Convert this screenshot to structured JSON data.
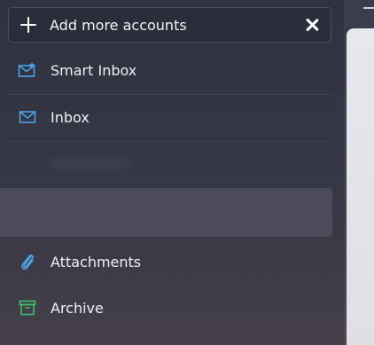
{
  "header": {
    "add_accounts_label": "Add more accounts"
  },
  "nav": {
    "items": [
      {
        "label": "Smart Inbox",
        "icon": "smart-inbox-icon"
      },
      {
        "label": "Inbox",
        "icon": "inbox-icon"
      },
      {
        "label": "Attachments",
        "icon": "paperclip-icon"
      },
      {
        "label": "Archive",
        "icon": "archive-icon"
      }
    ]
  },
  "colors": {
    "accent_blue": "#4aa3e8",
    "archive_green": "#3fbf6a",
    "sidebar_bg": "#343644",
    "selected_bg": "#4b4b59"
  }
}
